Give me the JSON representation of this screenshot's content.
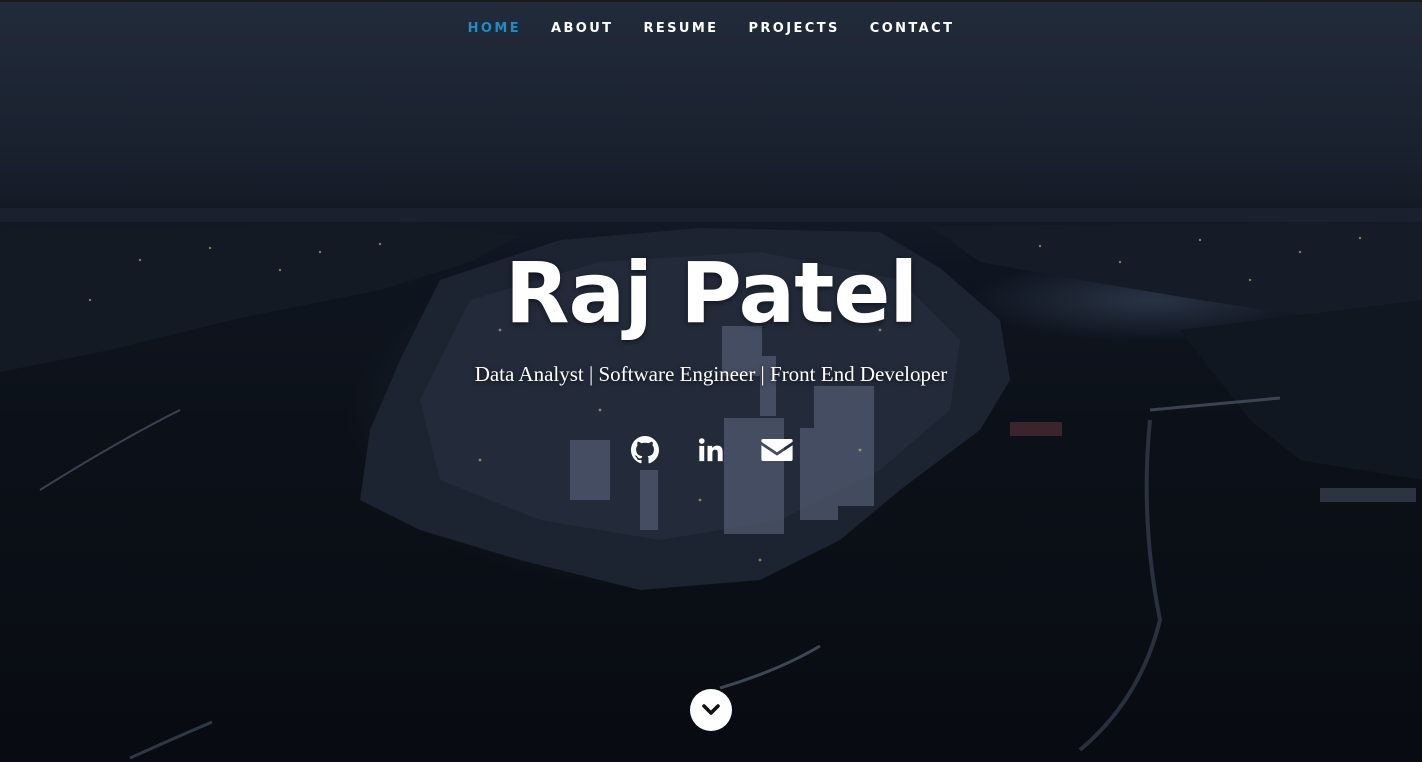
{
  "nav": {
    "items": [
      {
        "label": "HOME",
        "active": true
      },
      {
        "label": "ABOUT",
        "active": false
      },
      {
        "label": "RESUME",
        "active": false
      },
      {
        "label": "PROJECTS",
        "active": false
      },
      {
        "label": "CONTACT",
        "active": false
      }
    ],
    "active_color": "#1c8dc7"
  },
  "hero": {
    "name": "Raj Patel",
    "tagline": "Data Analyst | Software Engineer | Front End Developer"
  },
  "social": [
    {
      "icon": "github-icon"
    },
    {
      "icon": "linkedin-icon"
    },
    {
      "icon": "envelope-icon"
    }
  ],
  "scroll": {
    "icon": "chevron-down-icon"
  }
}
